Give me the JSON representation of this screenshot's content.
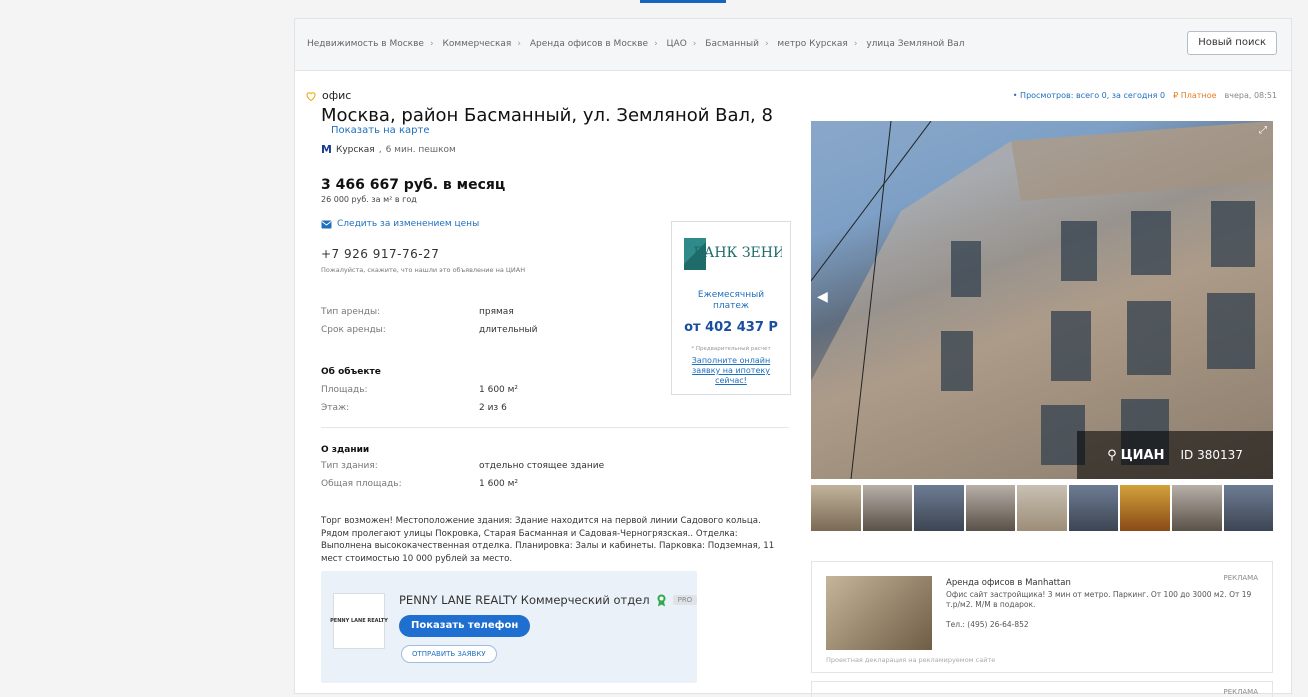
{
  "breadcrumbs": {
    "items": [
      "Недвижимость в Москве",
      "Коммерческая",
      "Аренда офисов в Москве",
      "ЦАО",
      "Басманный",
      "метро Курская",
      "улица Земляной Вал"
    ],
    "new_search": "Новый поиск"
  },
  "listing": {
    "type": "офис",
    "address": "Москва, район Басманный, ул. Земляной Вал, 8",
    "map_link": "Показать на карте",
    "metro_station": "Курская",
    "metro_walk": "6 мин. пешком",
    "price": "3 466 667 руб. в месяц",
    "price_per_m": "26 000 руб. за м² в год",
    "follow_price": "Следить за изменением цены",
    "phone": "+7 926 917-76-27",
    "phone_note": "Пожалуйста, скажите, что нашли это объявление на ЦИАН",
    "rent_type_label": "Тип аренды:",
    "rent_type_value": "прямая",
    "rent_term_label": "Срок аренды:",
    "rent_term_value": "длительный",
    "about_object": "Об объекте",
    "area_label": "Площадь:",
    "area_value": "1 600 м²",
    "floor_label": "Этаж:",
    "floor_value": "2 из 6",
    "about_building": "О здании",
    "building_type_label": "Тип здания:",
    "building_type_value": "отдельно стоящее здание",
    "total_area_label": "Общая площадь:",
    "total_area_value": "1 600 м²",
    "description": "Торг возможен! Местоположение здания: Здание находится на первой линии Садового кольца. Рядом пролегают улицы Покровка, Старая Басманная и Садовая-Черногрязская.. Отделка: Выполнена высококачественная отделка. Планировка: Залы и кабинеты. Парковка: Подземная, 11 мест стоимостью 10 000 рублей за место."
  },
  "agent": {
    "logo_text": "PENNY LANE REALTY",
    "name": "PENNY LANE REALTY Коммерческий отдел",
    "pro": "PRO",
    "show_phone": "Показать телефон",
    "send_request": "ОТПРАВИТЬ ЗАЯВКУ"
  },
  "bank": {
    "name": "БАНК ЗЕНИТ",
    "promo": "Ежемесячный платеж",
    "amount": "от 402 437 Р",
    "note": "* Предварительный расчет",
    "link": "Заполните онлайн заявку на ипотеку сейчас!"
  },
  "stats": {
    "views": "Просмотров: всего 0, за сегодня 0",
    "paid": "Платное",
    "time": "вчера, 08:51"
  },
  "photo": {
    "brand": "ЦИАН",
    "id": "ID 380137",
    "thumb_count": 9
  },
  "ad": {
    "label": "РЕКЛАМА",
    "title": "Аренда офисов в Manhattan",
    "text": "Офис сайт застройщика! 3 мин от метро. Паркинг. От 100 до 3000 м2. От 19 т.р/м2. М/М в подарок.",
    "tel": "Тел.: (495) 26-64-852",
    "footer": "Проектная декларация на рекламируемом сайте"
  },
  "ad2": {
    "label": "РЕКЛАМА"
  },
  "colors": {
    "link": "#1f6fbf",
    "accent": "#1565c0",
    "paid": "#e67e22"
  }
}
